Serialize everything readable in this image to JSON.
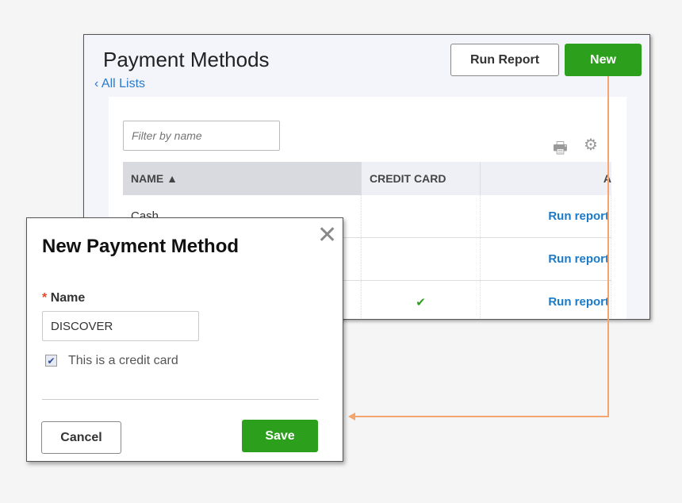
{
  "page": {
    "title": "Payment Methods",
    "back_link": "All Lists",
    "run_report": "Run Report",
    "new": "New",
    "filter_placeholder": "Filter by name",
    "columns": [
      "NAME ▲",
      "CREDIT CARD",
      "A"
    ],
    "rows": [
      {
        "name": "Cash",
        "credit_card": false,
        "action": "Run report"
      },
      {
        "name": "",
        "credit_card": false,
        "action": "Run report"
      },
      {
        "name": "",
        "credit_card": true,
        "action": "Run report"
      }
    ]
  },
  "dialog": {
    "title": "New Payment Method",
    "required_mark": "*",
    "name_label": "Name",
    "name_value": "DISCOVER",
    "checkbox_label": "This is a credit card",
    "checkbox_checked": true,
    "cancel": "Cancel",
    "save": "Save"
  },
  "colors": {
    "accent_green": "#2ca01c",
    "link_blue": "#1b7ac8",
    "arrow": "#f4a56e"
  }
}
